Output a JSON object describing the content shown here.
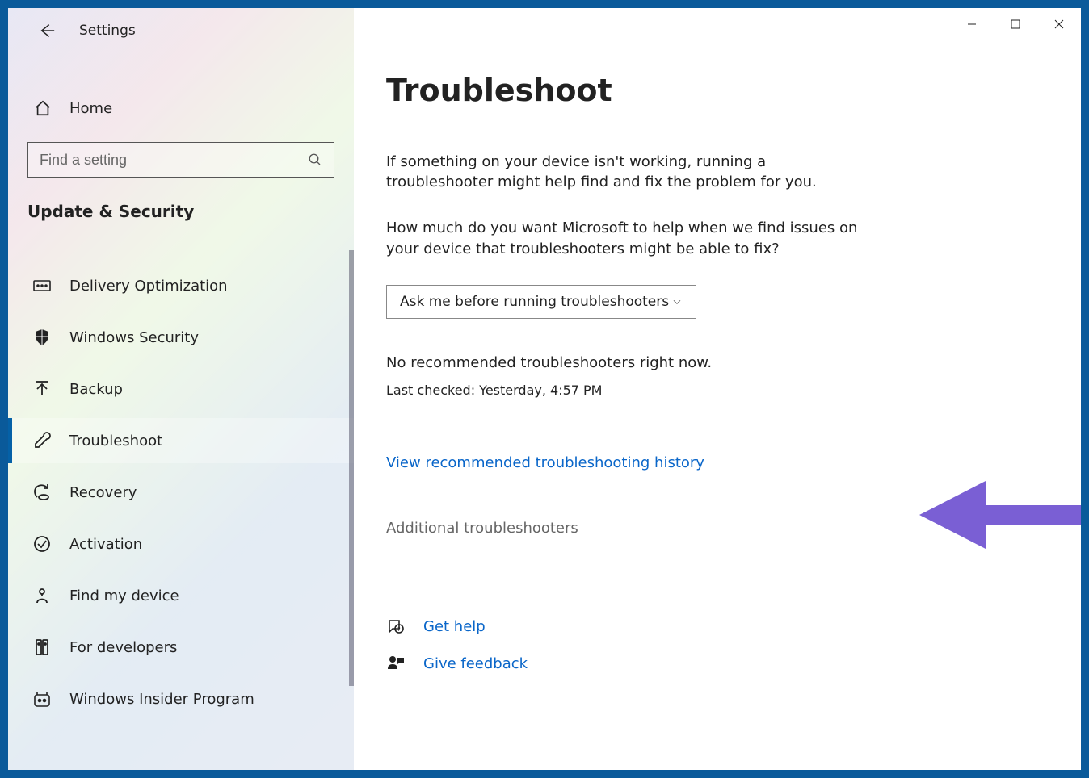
{
  "app_title": "Settings",
  "home_label": "Home",
  "search_placeholder": "Find a setting",
  "section_title": "Update & Security",
  "sidebar_items": [
    {
      "id": "delivery-optimization",
      "label": "Delivery Optimization",
      "icon": "delivery-icon"
    },
    {
      "id": "windows-security",
      "label": "Windows Security",
      "icon": "shield-icon"
    },
    {
      "id": "backup",
      "label": "Backup",
      "icon": "backup-icon"
    },
    {
      "id": "troubleshoot",
      "label": "Troubleshoot",
      "icon": "wrench-icon",
      "active": true
    },
    {
      "id": "recovery",
      "label": "Recovery",
      "icon": "recovery-icon"
    },
    {
      "id": "activation",
      "label": "Activation",
      "icon": "check-circle-icon"
    },
    {
      "id": "find-my-device",
      "label": "Find my device",
      "icon": "find-device-icon"
    },
    {
      "id": "for-developers",
      "label": "For developers",
      "icon": "developer-icon"
    },
    {
      "id": "windows-insider",
      "label": "Windows Insider Program",
      "icon": "insider-icon"
    }
  ],
  "main": {
    "title": "Troubleshoot",
    "intro": "If something on your device isn't working, running a troubleshooter might help find and fix the problem for you.",
    "question": "How much do you want Microsoft to help when we find issues on your device that troubleshooters might be able to fix?",
    "dropdown_selected": "Ask me before running troubleshooters",
    "status": "No recommended troubleshooters right now.",
    "last_checked": "Last checked: Yesterday, 4:57 PM",
    "history_link": "View recommended troubleshooting history",
    "additional": "Additional troubleshooters",
    "get_help": "Get help",
    "give_feedback": "Give feedback"
  },
  "annotation": {
    "arrow_color": "#7a5fd4"
  }
}
